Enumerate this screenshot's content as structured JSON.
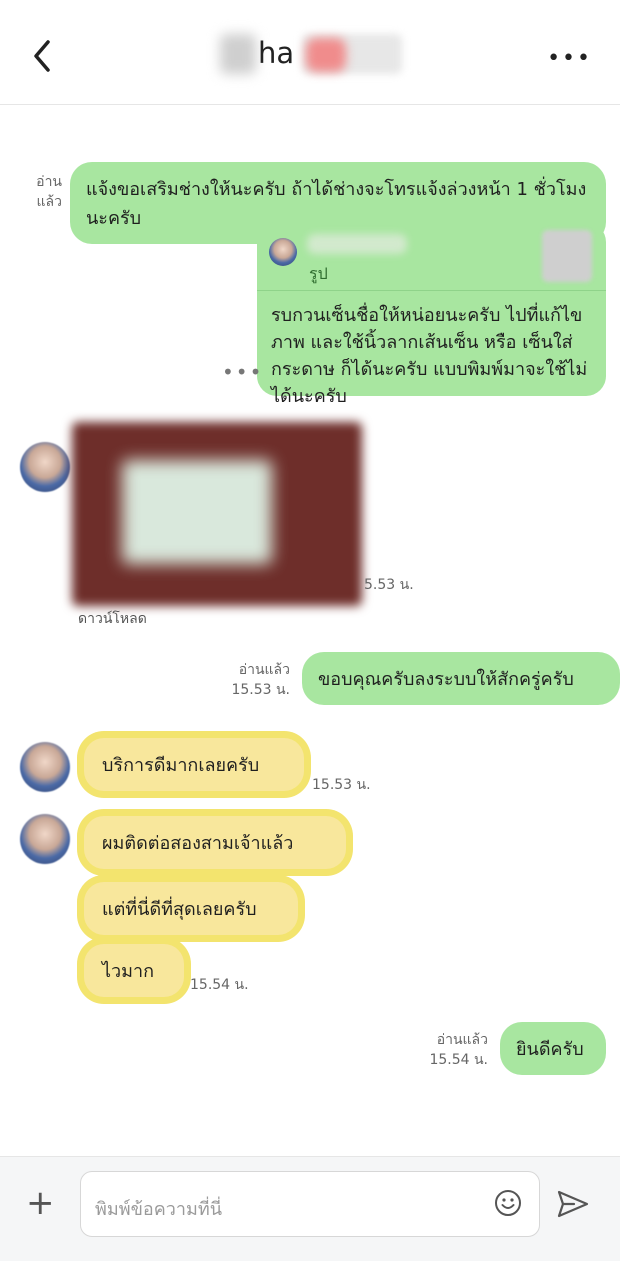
{
  "header": {
    "title_visible_fragment": "ha",
    "back_icon": "chevron-left-icon",
    "more_icon": "more-horizontal-icon"
  },
  "messages": [
    {
      "type": "outgoing",
      "status": "อ่านแล้ว",
      "text": "แจ้งขอเสริมช่างให้นะครับ ถ้าได้ช่างจะโทรแจ้งล่วงหน้า 1 ชั่วโมง นะครับ"
    },
    {
      "type": "outgoing_reply",
      "reply_label": "รูป",
      "text": "รบกวนเซ็นชื่อให้หน่อยนะครับ ไปที่แก้ไขภาพ และใช้นิ้วลากเส้นเซ็น หรือ เซ็นใส่กระดาษ ก็ได้นะครับ แบบพิมพ์มาจะใช้ไม่ได้นะครับ"
    },
    {
      "type": "incoming_image",
      "time": "5.53 น.",
      "download_label": "ดาวน์โหลด"
    },
    {
      "type": "outgoing",
      "status": "อ่านแล้ว",
      "time": "15.53 น.",
      "text": "ขอบคุณครับลงระบบให้สักครู่ครับ"
    },
    {
      "type": "incoming",
      "text": "บริการดีมากเลยครับ",
      "time": "15.53 น."
    },
    {
      "type": "incoming_group",
      "items": [
        "ผมติดต่อสองสามเจ้าแล้ว",
        "แต่ที่นี่ดีที่สุดเลยครับ",
        "ไวมาก"
      ],
      "time": "15.54 น."
    },
    {
      "type": "outgoing",
      "status": "อ่านแล้ว",
      "time": "15.54 น.",
      "text": "ยินดีครับ"
    }
  ],
  "input": {
    "placeholder": "พิมพ์ข้อความที่นี่"
  },
  "colors": {
    "outgoing_bubble": "#a8e6a0",
    "incoming_highlight": "#f3e46e"
  }
}
